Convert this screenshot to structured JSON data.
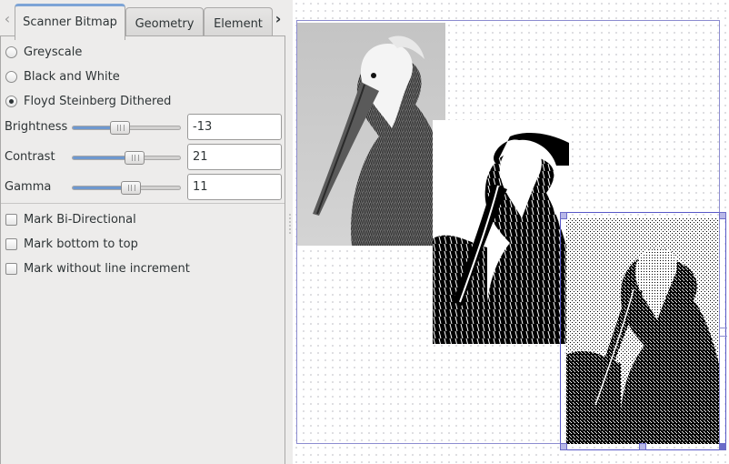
{
  "tabs": [
    {
      "label": "Scanner Bitmap",
      "active": true
    },
    {
      "label": "Geometry",
      "active": false
    },
    {
      "label": "Element",
      "active": false
    }
  ],
  "modes": [
    {
      "label": "Greyscale",
      "checked": false
    },
    {
      "label": "Black and White",
      "checked": false
    },
    {
      "label": "Floyd Steinberg Dithered",
      "checked": true
    }
  ],
  "sliders": [
    {
      "label": "Brightness",
      "value": "-13",
      "fraction": 0.44
    },
    {
      "label": "Contrast",
      "value": "21",
      "fraction": 0.58
    },
    {
      "label": "Gamma",
      "value": "11",
      "fraction": 0.54
    }
  ],
  "options": [
    {
      "label": "Mark Bi-Directional",
      "checked": false
    },
    {
      "label": "Mark bottom to top",
      "checked": false
    },
    {
      "label": "Mark without line increment",
      "checked": false
    }
  ],
  "colors": {
    "accent": "#6e98cf",
    "selection": "#5858c8"
  },
  "icons": {
    "scroll_left": "chevron-left-icon",
    "scroll_right": "chevron-right-icon"
  }
}
